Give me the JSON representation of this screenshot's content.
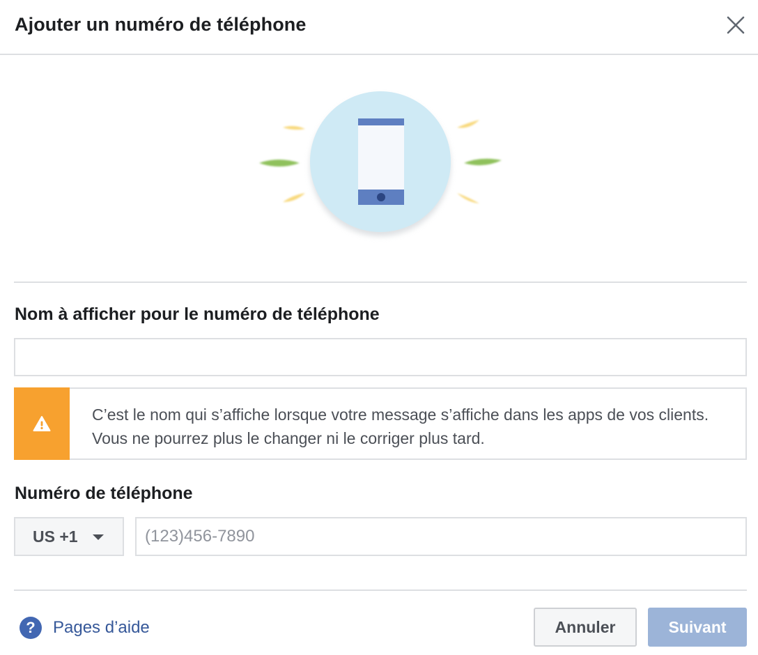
{
  "dialog": {
    "title": "Ajouter un numéro de téléphone",
    "close_icon": "close-icon"
  },
  "illustration": {
    "icon": "smartphone-icon",
    "colors": {
      "circle": "#cfeaf5",
      "phone_body": "#f5f8fc",
      "phone_bars": "#5e7fc1",
      "green_rays": "#8fc15c",
      "yellow_rays": "#f8d97e"
    }
  },
  "display_name": {
    "label": "Nom à afficher pour le numéro de téléphone",
    "value": "",
    "placeholder": ""
  },
  "warning": {
    "icon": "warning-icon",
    "text": "C’est le nom qui s’affiche lorsque votre message s’affiche dans les apps de vos clients. Vous ne pourrez plus le changer ni le corriger plus tard.",
    "color": "#f7a12f"
  },
  "phone": {
    "label": "Numéro de téléphone",
    "country_code": "US +1",
    "value": "",
    "placeholder": "(123)456-7890"
  },
  "footer": {
    "help_icon": "question-icon",
    "help_label": "Pages d’aide",
    "cancel_label": "Annuler",
    "next_label": "Suivant",
    "accent_color": "#4267b2"
  }
}
